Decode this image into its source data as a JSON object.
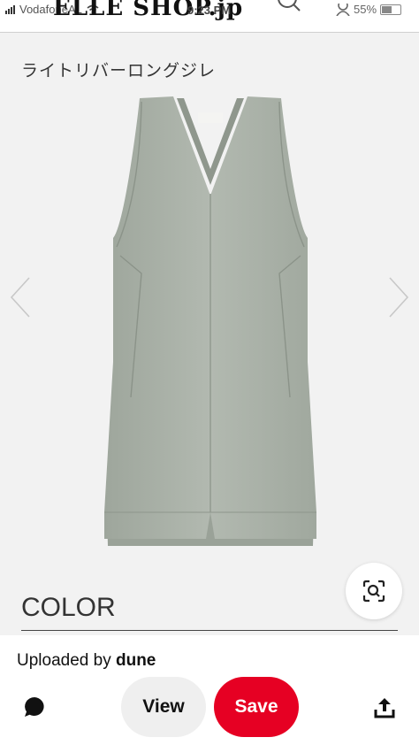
{
  "status_bar": {
    "carrier": "VodafoneAL",
    "time": "9:23 PM",
    "battery": "55%"
  },
  "site": {
    "logo": "ELLE SHOP.jp"
  },
  "product": {
    "title": "ライトリバーロングジレ",
    "section_heading": "COLOR"
  },
  "uploader": {
    "prefix": "Uploaded by",
    "name": "dune"
  },
  "actions": {
    "view_label": "View",
    "save_label": "Save"
  },
  "icons": {
    "comment": "comment-icon",
    "share": "share-icon",
    "lens": "visual-search-icon",
    "prev": "chevron-left-icon",
    "next": "chevron-right-icon"
  },
  "colors": {
    "save": "#e60023",
    "view": "#efefef",
    "vest": "#a8b0a6"
  }
}
